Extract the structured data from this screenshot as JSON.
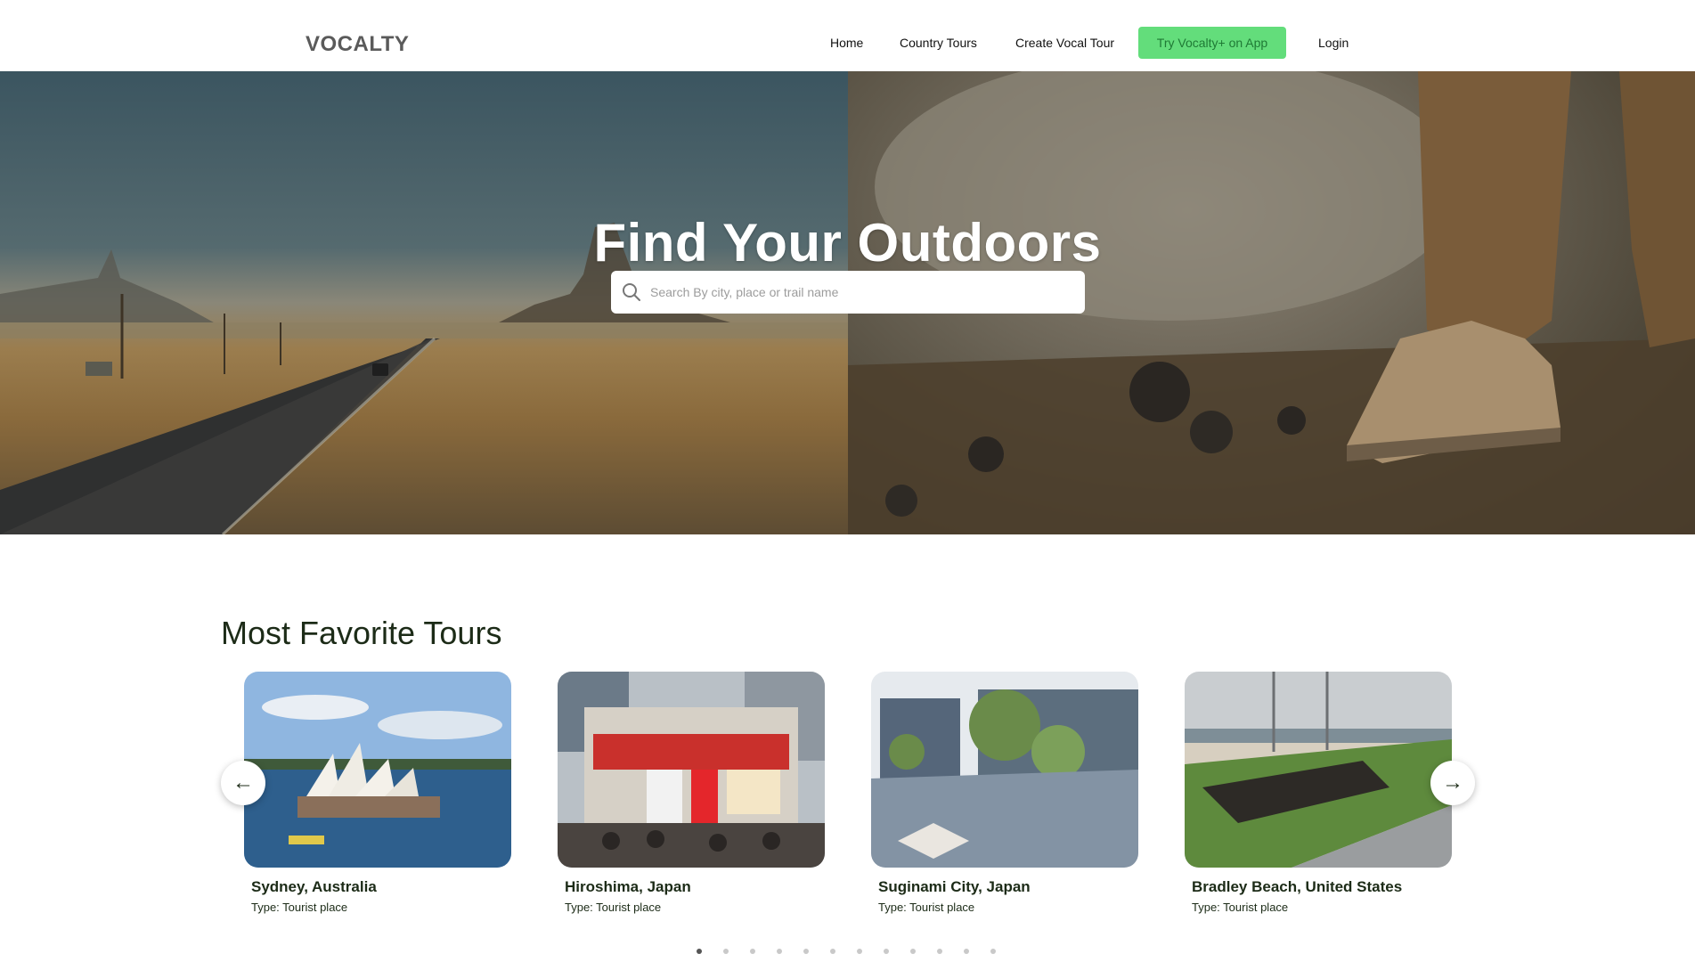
{
  "header": {
    "logo": "VOCALTY",
    "nav": [
      {
        "label": "Home"
      },
      {
        "label": "Country Tours"
      },
      {
        "label": "Create Vocal Tour"
      }
    ],
    "cta_label": "Try Vocalty+ on App",
    "login_label": "Login"
  },
  "hero": {
    "title": "Find Your Outdoors",
    "search_placeholder": "Search By city, place or trail name"
  },
  "favorites": {
    "title": "Most Favorite Tours",
    "cards": [
      {
        "title": "Sydney, Australia",
        "type": "Type: Tourist place"
      },
      {
        "title": "Hiroshima, Japan",
        "type": "Type: Tourist place"
      },
      {
        "title": "Suginami City, Japan",
        "type": "Type: Tourist place"
      },
      {
        "title": "Bradley Beach, United States",
        "type": "Type: Tourist place"
      }
    ],
    "active_page": 1,
    "page_count": 12
  },
  "colors": {
    "cta_bg": "#63dd7b",
    "cta_text": "#1f7a35",
    "heading": "#1c2b17"
  }
}
